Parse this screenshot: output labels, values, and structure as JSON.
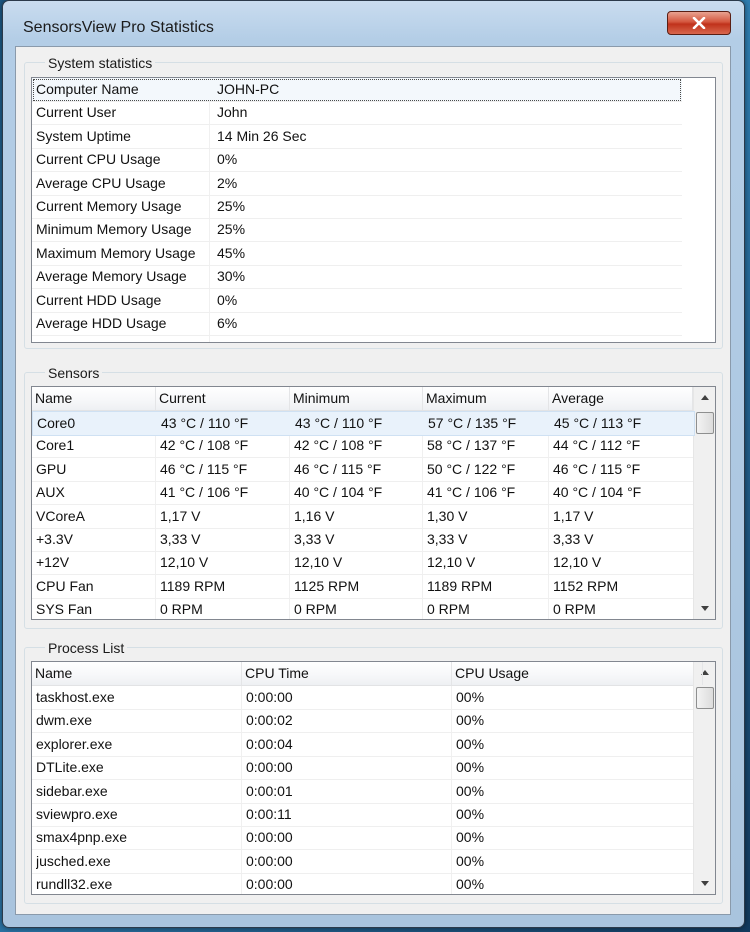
{
  "window": {
    "title": "SensorsView Pro Statistics"
  },
  "system_statistics": {
    "label": "System statistics",
    "rows": [
      {
        "name": "Computer Name",
        "value": "JOHN-PC"
      },
      {
        "name": "Current User",
        "value": "John"
      },
      {
        "name": "System Uptime",
        "value": "14 Min 26 Sec"
      },
      {
        "name": "Current CPU Usage",
        "value": "0%"
      },
      {
        "name": "Average CPU Usage",
        "value": "2%"
      },
      {
        "name": "Current Memory Usage",
        "value": "25%"
      },
      {
        "name": "Minimum Memory Usage",
        "value": "25%"
      },
      {
        "name": "Maximum Memory Usage",
        "value": "45%"
      },
      {
        "name": "Average Memory Usage",
        "value": "30%"
      },
      {
        "name": "Current HDD Usage",
        "value": "0%"
      },
      {
        "name": "Average HDD Usage",
        "value": "6%"
      }
    ]
  },
  "sensors": {
    "label": "Sensors",
    "columns": [
      "Name",
      "Current",
      "Minimum",
      "Maximum",
      "Average"
    ],
    "rows": [
      [
        "Core0",
        "43 °C / 110 °F",
        "43 °C / 110 °F",
        "57 °C / 135 °F",
        "45 °C / 113 °F"
      ],
      [
        "Core1",
        "42 °C / 108 °F",
        "42 °C / 108 °F",
        "58 °C / 137 °F",
        "44 °C / 112 °F"
      ],
      [
        "GPU",
        "46 °C / 115 °F",
        "46 °C / 115 °F",
        "50 °C / 122 °F",
        "46 °C / 115 °F"
      ],
      [
        "AUX",
        "41 °C / 106 °F",
        "40 °C / 104 °F",
        "41 °C / 106 °F",
        "40 °C / 104 °F"
      ],
      [
        "VCoreA",
        "1,17 V",
        "1,16 V",
        "1,30 V",
        "1,17 V"
      ],
      [
        "+3.3V",
        "3,33 V",
        "3,33 V",
        "3,33 V",
        "3,33 V"
      ],
      [
        "+12V",
        "12,10 V",
        "12,10 V",
        "12,10 V",
        "12,10 V"
      ],
      [
        "CPU Fan",
        "1189 RPM",
        "1125 RPM",
        "1189 RPM",
        "1152 RPM"
      ],
      [
        "SYS Fan",
        "0 RPM",
        "0 RPM",
        "0 RPM",
        "0 RPM"
      ]
    ]
  },
  "process_list": {
    "label": "Process List",
    "columns": [
      "Name",
      "CPU Time",
      "CPU Usage"
    ],
    "rows": [
      [
        "taskhost.exe",
        "0:00:00",
        "00%"
      ],
      [
        "dwm.exe",
        "0:00:02",
        "00%"
      ],
      [
        "explorer.exe",
        "0:00:04",
        "00%"
      ],
      [
        "DTLite.exe",
        "0:00:00",
        "00%"
      ],
      [
        "sidebar.exe",
        "0:00:01",
        "00%"
      ],
      [
        "sviewpro.exe",
        "0:00:11",
        "00%"
      ],
      [
        "smax4pnp.exe",
        "0:00:00",
        "00%"
      ],
      [
        "jusched.exe",
        "0:00:00",
        "00%"
      ],
      [
        "rundll32.exe",
        "0:00:00",
        "00%"
      ]
    ]
  }
}
